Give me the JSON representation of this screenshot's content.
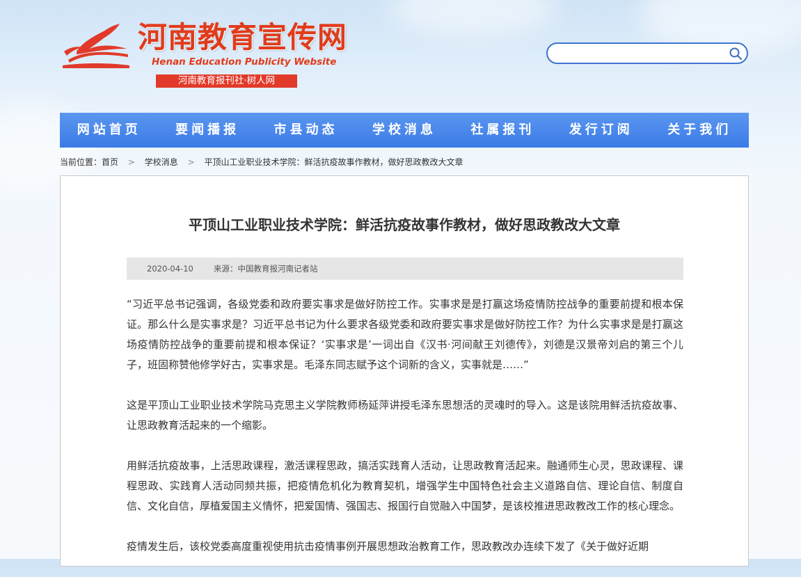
{
  "header": {
    "title": "河南教育宣传网",
    "subtitle": "Henan Education Publicity Website",
    "tag": "河南教育报刊社·树人网"
  },
  "search": {
    "placeholder": "",
    "icon": "search-icon"
  },
  "nav": {
    "items": [
      "网站首页",
      "要闻播报",
      "市县动态",
      "学校消息",
      "社属报刊",
      "发行订阅",
      "关于我们"
    ]
  },
  "breadcrumb": {
    "prefix": "当前位置：",
    "items": [
      "首页",
      "学校消息",
      "平顶山工业职业技术学院：鲜活抗疫故事作教材，做好思政教改大文章"
    ]
  },
  "article": {
    "title": "平顶山工业职业技术学院：鲜活抗疫故事作教材，做好思政教改大文章",
    "date": "2020-04-10",
    "source": "来源：中国教育报河南记者站",
    "paragraphs": [
      "“习近平总书记强调，各级党委和政府要实事求是做好防控工作。实事求是是打赢这场疫情防控战争的重要前提和根本保证。那么什么是实事求是？习近平总书记为什么要求各级党委和政府要实事求是做好防控工作？为什么实事求是是打赢这场疫情防控战争的重要前提和根本保证？‘实事求是’一词出自《汉书·河间献王刘德传》，刘德是汉景帝刘启的第三个儿子，班固称赞他修学好古，实事求是。毛泽东同志赋予这个词新的含义，实事就是……”",
      "这是平顶山工业职业技术学院马克思主义学院教师杨延萍讲授毛泽东思想活的灵魂时的导入。这是该院用鲜活抗疫故事、让思政教育活起来的一个缩影。",
      "用鲜活抗疫故事，上活思政课程，激活课程思政，搞活实践育人活动，让思政教育活起来。融通师生心灵，思政课程、课程思政、实践育人活动同频共振，把疫情危机化为教育契机，增强学生中国特色社会主义道路自信、理论自信、制度自信、文化自信，厚植爱国主义情怀，把爱国情、强国志、报国行自觉融入中国梦，是该校推进思政教改工作的核心理念。",
      "疫情发生后，该校党委高度重视使用抗击疫情事例开展思想政治教育工作，思政教改办连续下发了《关于做好近期"
    ]
  },
  "colors": {
    "brand_red": "#e03c1c",
    "nav_blue": "#3c7ae6"
  }
}
